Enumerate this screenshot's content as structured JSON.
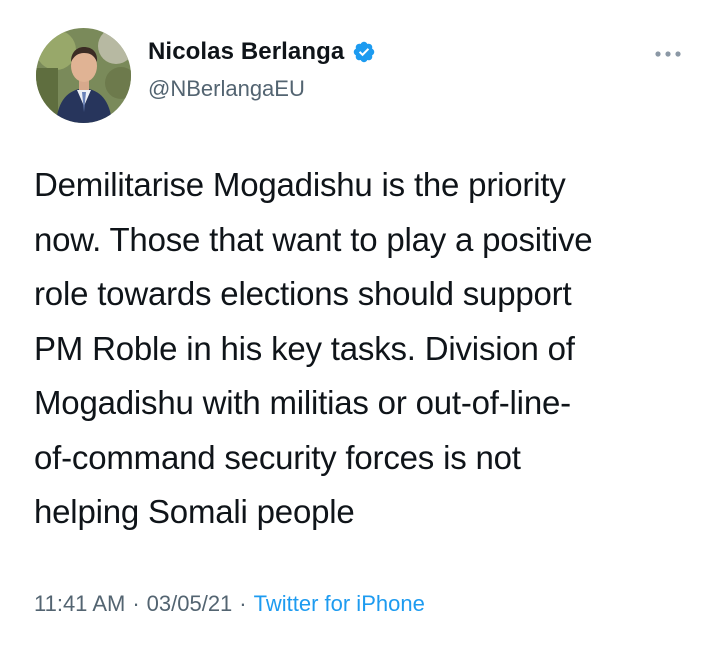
{
  "author": {
    "display_name": "Nicolas Berlanga",
    "handle": "@NBerlangaEU",
    "verified": true,
    "avatar_icon": "profile-photo"
  },
  "menu_icon": "more-options-icon",
  "tweet": {
    "text": "Demilitarise Mogadishu is the priority\nnow. Those that want to play a positive\nrole towards elections should support\nPM Roble in his key tasks. Division of\nMogadishu with militias or out-of-line-\nof-command security forces is not\nhelping Somali people"
  },
  "meta": {
    "time": "11:41 AM",
    "date": "03/05/21",
    "separator": "·",
    "source": "Twitter for iPhone"
  },
  "colors": {
    "text": "#0f1419",
    "secondary": "#536471",
    "link": "#1d9bf0",
    "verified": "#1d9bf0"
  }
}
